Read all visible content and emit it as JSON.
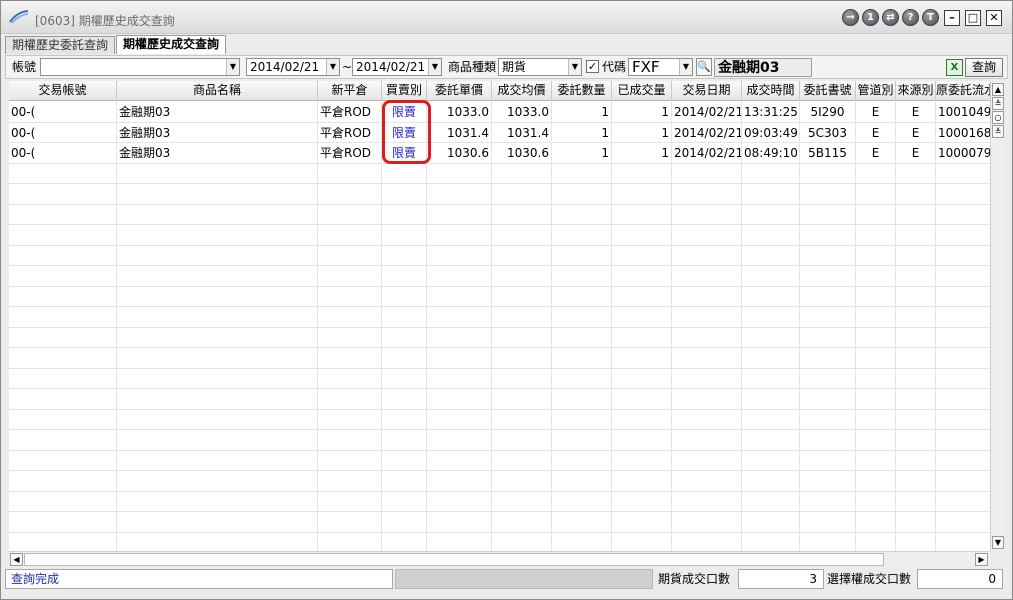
{
  "window": {
    "title": "[0603] 期權歷史成交查詢"
  },
  "titlebar_buttons": [
    "→",
    "1",
    "⇄",
    "?",
    "T"
  ],
  "tabs": [
    {
      "label": "期權歷史委託查詢",
      "active": false
    },
    {
      "label": "期權歷史成交查詢",
      "active": true
    }
  ],
  "filter": {
    "account_label": "帳號",
    "account_value": "",
    "date_from": "2014/02/21",
    "date_sep": "~",
    "date_to": "2014/02/21",
    "product_type_label": "商品種類",
    "product_type_value": "期貨",
    "code_checked": true,
    "code_label": "代碼",
    "code_value": "FXF",
    "product_name": "金融期03",
    "query_label": "查詢"
  },
  "table": {
    "headers": [
      "交易帳號",
      "商品名稱",
      "新平倉",
      "買賣別",
      "委託單價",
      "成交均價",
      "委託數量",
      "已成交量",
      "交易日期",
      "成交時間",
      "委託書號",
      "管道別",
      "來源別",
      "原委託流水"
    ],
    "rows": [
      [
        "00-(",
        "金融期03",
        "平倉ROD",
        "限賣",
        "1033.0",
        "1033.0",
        "1",
        "1",
        "2014/02/21",
        "13:31:25",
        "5I290",
        "E",
        "E",
        "1001049"
      ],
      [
        "00-(",
        "金融期03",
        "平倉ROD",
        "限賣",
        "1031.4",
        "1031.4",
        "1",
        "1",
        "2014/02/21",
        "09:03:49",
        "5C303",
        "E",
        "E",
        "1000168"
      ],
      [
        "00-(",
        "金融期03",
        "平倉ROD",
        "限賣",
        "1030.6",
        "1030.6",
        "1",
        "1",
        "2014/02/21",
        "08:49:10",
        "5B115",
        "E",
        "E",
        "1000079"
      ]
    ]
  },
  "status": {
    "message": "查詢完成",
    "futures_count_label": "期貨成交口數",
    "futures_count": "3",
    "options_count_label": "選擇權成交口數",
    "options_count": "0"
  },
  "colors": {
    "highlight": "#e01b1b",
    "buysell_text": "#1f1fc8",
    "status_text": "#1e2fa8"
  }
}
